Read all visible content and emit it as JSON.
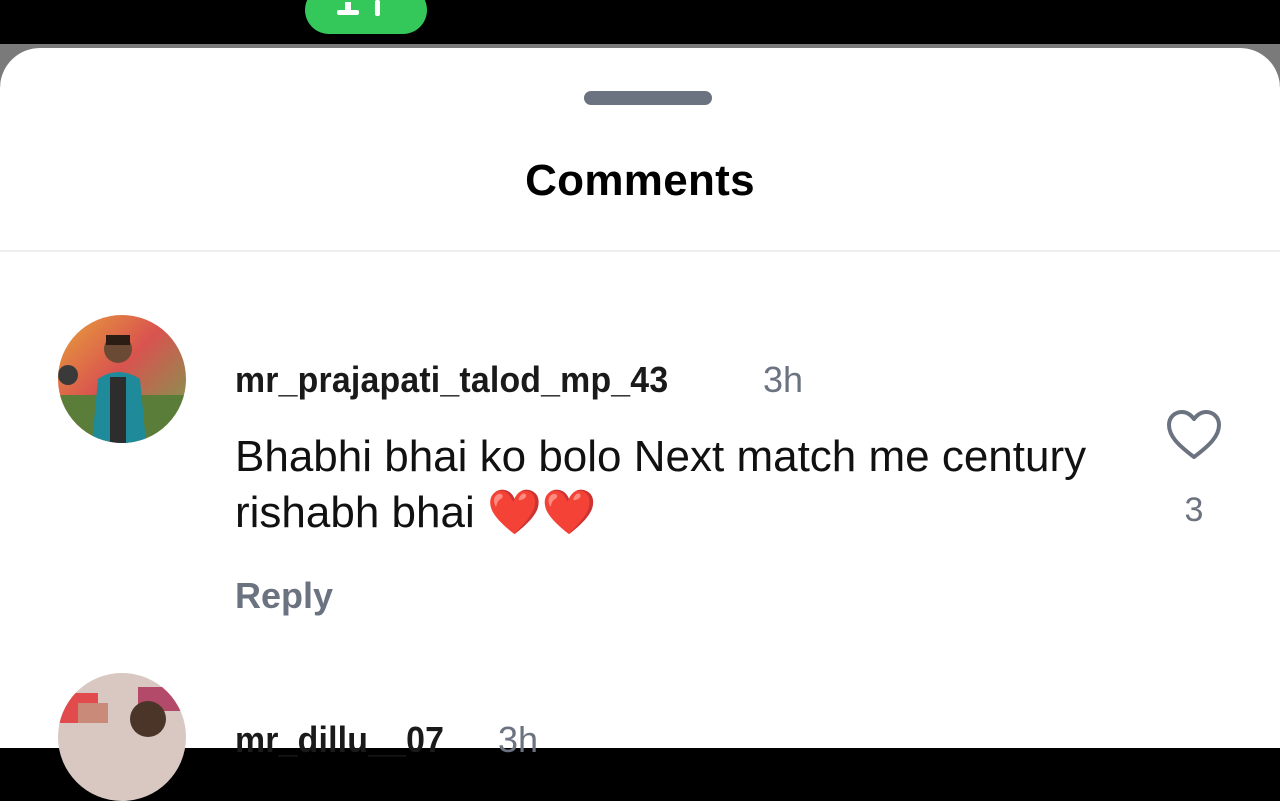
{
  "sheet": {
    "title": "Comments"
  },
  "comments": [
    {
      "username": "mr_prajapati_talod_mp_43",
      "time": "3h",
      "text": "Bhabhi bhai ko bolo  Next match me century rishabh bhai ",
      "emoji": "❤️❤️",
      "reply_label": "Reply",
      "like_count": "3"
    },
    {
      "username": "mr_dillu__07",
      "time": "3h"
    }
  ],
  "icons": {
    "like": "heart-outline-icon",
    "call": "call-indicator-icon"
  },
  "colors": {
    "call_pill": "#34c759",
    "emoji_heart": "#e41b2a",
    "secondary_text": "#6b7280"
  }
}
